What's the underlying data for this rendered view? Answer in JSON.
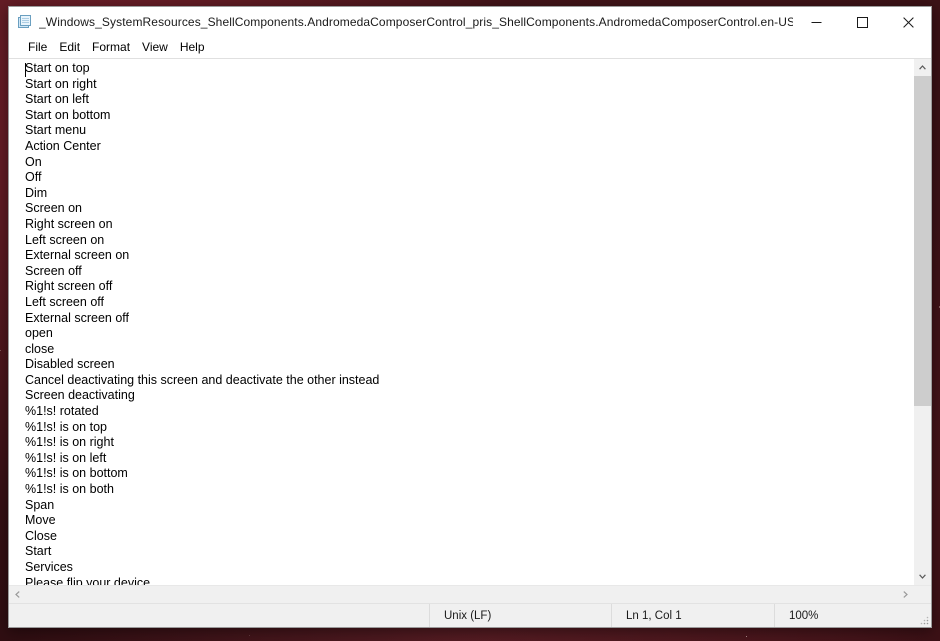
{
  "window": {
    "title": "_Windows_SystemResources_ShellComponents.AndromedaComposerControl_pris_ShellComponents.AndromedaComposerControl.en-US - Notepad",
    "app_icon": "notepad-document-icon",
    "controls": {
      "minimize": "minimize-icon",
      "maximize": "maximize-icon",
      "close": "close-icon"
    }
  },
  "menu": {
    "items": [
      {
        "label": "File"
      },
      {
        "label": "Edit"
      },
      {
        "label": "Format"
      },
      {
        "label": "View"
      },
      {
        "label": "Help"
      }
    ]
  },
  "editor": {
    "lines": [
      "Start on top",
      "Start on right",
      "Start on left",
      "Start on bottom",
      "Start menu",
      "Action Center",
      "On",
      "Off",
      "Dim",
      "Screen on",
      "Right screen on",
      "Left screen on",
      "External screen on",
      "Screen off",
      "Right screen off",
      "Left screen off",
      "External screen off",
      "open",
      "close",
      "Disabled screen",
      "Cancel deactivating this screen and deactivate the other instead",
      "Screen deactivating",
      "%1!s! rotated",
      "%1!s! is on top",
      "%1!s! is on right",
      "%1!s! is on left",
      "%1!s! is on bottom",
      "%1!s! is on both",
      "Span",
      "Move",
      "Close",
      "Start",
      "Services",
      "Please flip your device."
    ]
  },
  "scrollbars": {
    "vertical": {
      "up_arrow": "chevron-up-icon",
      "down_arrow": "chevron-down-icon"
    },
    "horizontal": {
      "left_arrow": "chevron-left-icon",
      "right_arrow": "chevron-right-icon"
    }
  },
  "status_bar": {
    "line_ending": "Unix (LF)",
    "position": "Ln 1, Col 1",
    "zoom": "100%"
  },
  "colors": {
    "window_background": "#ffffff",
    "chrome": "#f0f0f0",
    "text": "#000000",
    "desktop": "#3b1216",
    "close_hover": "#e81123"
  }
}
